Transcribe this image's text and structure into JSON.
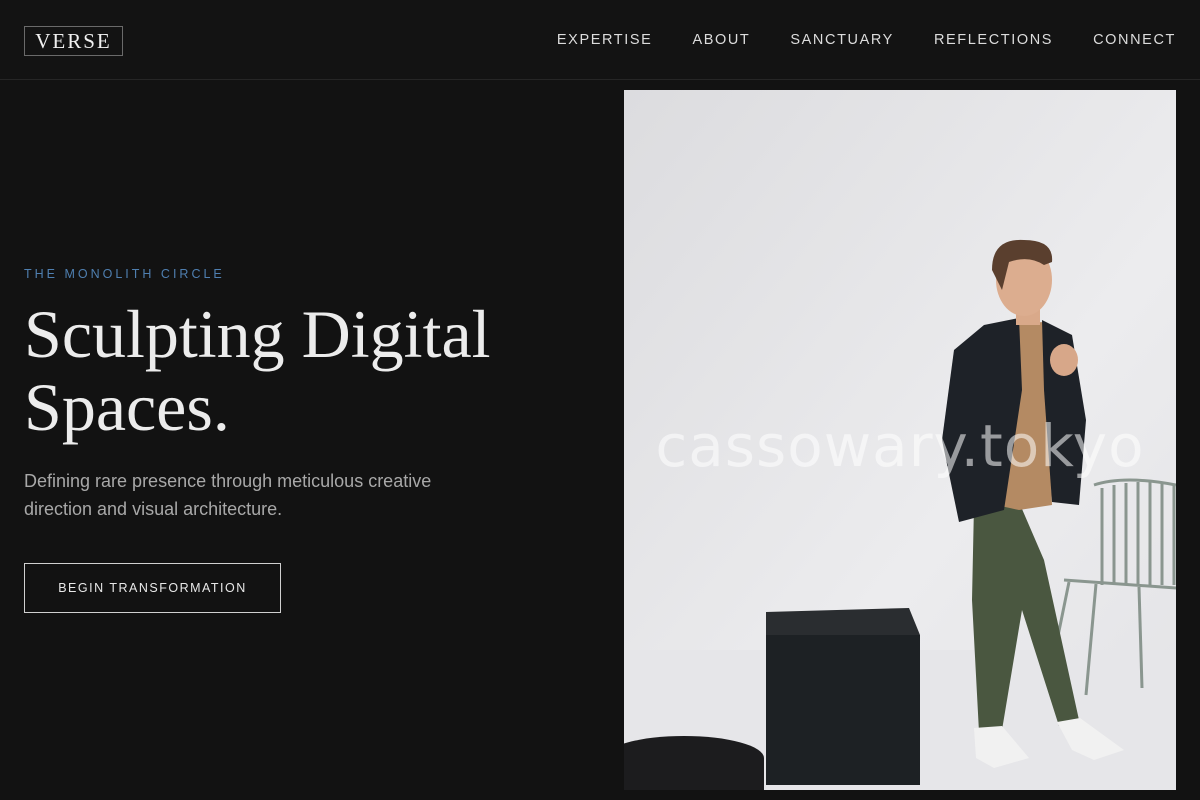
{
  "header": {
    "logo": "VERSE",
    "nav": [
      "EXPERTISE",
      "ABOUT",
      "SANCTUARY",
      "REFLECTIONS",
      "CONNECT"
    ]
  },
  "hero": {
    "eyebrow": "THE MONOLITH CIRCLE",
    "headline_line1": "Sculpting Digital",
    "headline_line2": "Spaces.",
    "lede": "Defining rare presence through meticulous creative direction and visual architecture.",
    "cta_label": "BEGIN TRANSFORMATION",
    "image_watermark": "cassowary.tokyo"
  },
  "colors": {
    "background": "#121212",
    "accent": "#4f7fb0",
    "text": "#ececec",
    "muted": "#a8a8a8"
  }
}
